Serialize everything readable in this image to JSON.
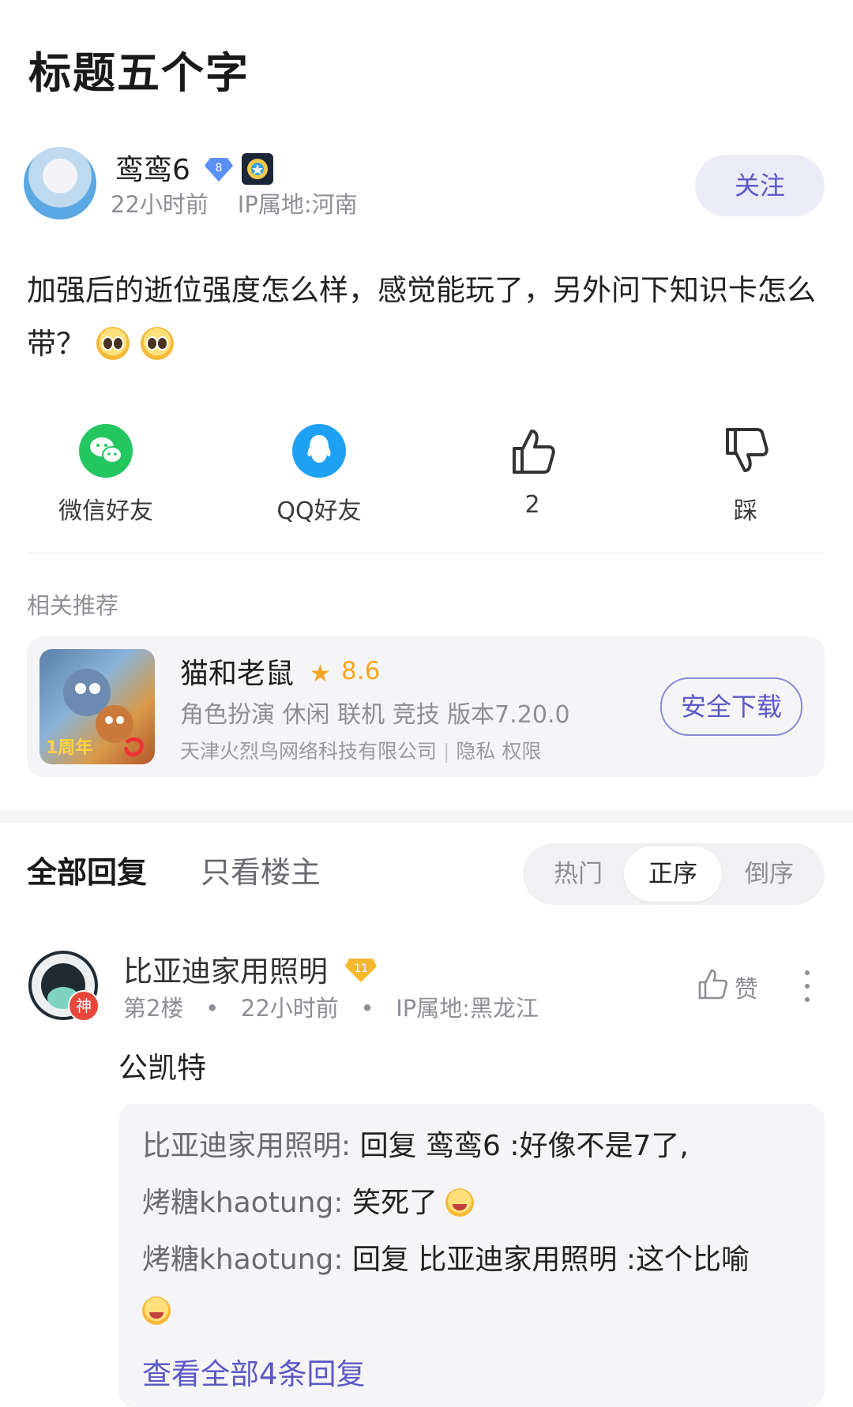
{
  "post": {
    "title": "标题五个字",
    "author": "鸾鸾6",
    "level": "8",
    "time": "22小时前",
    "ip": "IP属地:河南",
    "follow_label": "关注",
    "content": "加强后的逝位强度怎么样，感觉能玩了，另外问下知识卡怎么带？"
  },
  "actions": {
    "wechat_label": "微信好友",
    "qq_label": "QQ好友",
    "like_count": "2",
    "dislike_label": "踩"
  },
  "related": {
    "section_label": "相关推荐",
    "app_name": "猫和老鼠",
    "star": "★",
    "rating": "8.6",
    "tags": "角色扮演 休闲 联机 竞技   版本7.20.0",
    "developer": "天津火烈鸟网络科技有限公司",
    "sep": "|",
    "privacy": "隐私",
    "permissions": "权限",
    "download_label": "安全下载"
  },
  "tabs": {
    "all": "全部回复",
    "op_only": "只看楼主",
    "hot": "热门",
    "asc": "正序",
    "desc": "倒序"
  },
  "comment": {
    "name": "比亚迪家用照明",
    "vip_level": "11",
    "badge": "神",
    "floor": "第2楼",
    "dot": "•",
    "time": "22小时前",
    "ip": "IP属地:黑龙江",
    "like_label": "赞",
    "text": "公凯特",
    "replies": [
      {
        "who": "比亚迪家用照明:",
        "text": "回复 鸾鸾6 :好像不是7了,"
      },
      {
        "who": "烤糖khaotung:",
        "text": "笑死了"
      },
      {
        "who": "烤糖khaotung:",
        "text": "回复 比亚迪家用照明 :这个比喻"
      }
    ],
    "view_all": "查看全部4条回复"
  }
}
